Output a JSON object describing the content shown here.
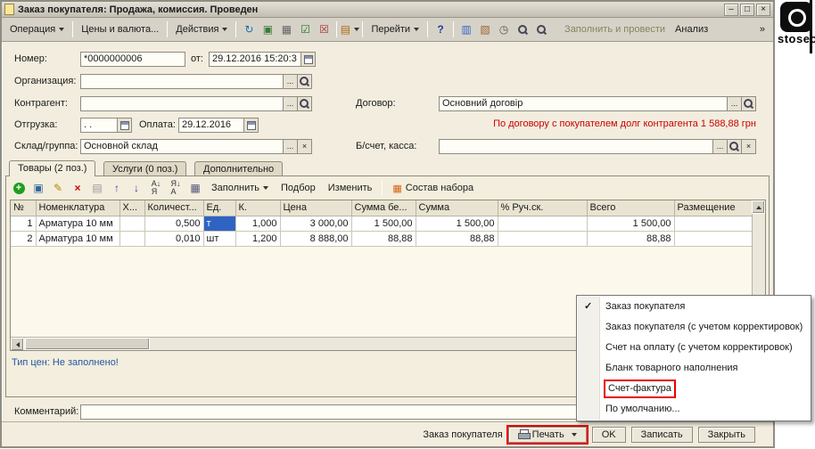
{
  "window": {
    "title": "Заказ покупателя: Продажа, комиссия. Проведен",
    "minimize": "–",
    "maximize": "□",
    "close": "×"
  },
  "toolbar": {
    "operation": "Операция",
    "prices": "Цены и валюта...",
    "actions": "Действия",
    "goto": "Перейти",
    "help": "?",
    "fill_and_post": "Заполнить и провести",
    "analysis": "Анализ",
    "overflow": "»"
  },
  "form": {
    "number_label": "Номер:",
    "number_value": "*0000000006",
    "date_label": "от:",
    "date_value": "29.12.2016 15:20:3",
    "org_label": "Организация:",
    "org_value": "",
    "contragent_label": "Контрагент:",
    "contragent_value": "",
    "contract_label": "Договор:",
    "contract_value": "Основний договір",
    "shipping_label": "Отгрузка:",
    "shipping_value": ".  .",
    "payment_label": "Оплата:",
    "payment_value": "29.12.2016",
    "debt_warning": "По договору с покупателем долг контрагента 1 588,88 грн",
    "warehouse_label": "Склад/группа:",
    "warehouse_value": "Основной склад",
    "account_label": "Б/счет, касса:",
    "account_value": ""
  },
  "tabs": [
    {
      "label": "Товары (2 поз.)"
    },
    {
      "label": "Услуги (0 поз.)"
    },
    {
      "label": "Дополнительно"
    }
  ],
  "table_toolbar": {
    "fill": "Заполнить",
    "pick": "Подбор",
    "change": "Изменить",
    "set_content": "Состав набора"
  },
  "table": {
    "columns": [
      "№",
      "Номенклатура",
      "Х...",
      "Количест...",
      "Ед.",
      "К.",
      "Цена",
      "Сумма бе...",
      "Сумма",
      "% Руч.ск.",
      "Всего",
      "Размещение"
    ],
    "rows": [
      [
        "1",
        "Арматура 10 мм",
        "",
        "0,500",
        "т",
        "1,000",
        "3 000,00",
        "1 500,00",
        "1 500,00",
        "",
        "1 500,00",
        ""
      ],
      [
        "2",
        "Арматура 10 мм",
        "",
        "0,010",
        "шт",
        "1,200",
        "8 888,00",
        "88,88",
        "88,88",
        "",
        "88,88",
        ""
      ]
    ]
  },
  "price_type": {
    "label": "Тип цен:",
    "value": "Не заполнено!"
  },
  "comment": {
    "label": "Комментарий:",
    "value": ""
  },
  "footer": {
    "doc_type": "Заказ покупателя",
    "print": "Печать",
    "ok": "OK",
    "save": "Записать",
    "close": "Закрыть"
  },
  "menu": {
    "items": [
      {
        "label": "Заказ покупателя"
      },
      {
        "label": "Заказ покупателя (с учетом корректировок)"
      },
      {
        "label": "Счет на оплату (с учетом корректировок)"
      },
      {
        "label": "Бланк товарного наполнения"
      },
      {
        "label": "Счет-фактура"
      },
      {
        "label": "По умолчанию..."
      }
    ]
  },
  "logo": {
    "text": "stosec"
  }
}
